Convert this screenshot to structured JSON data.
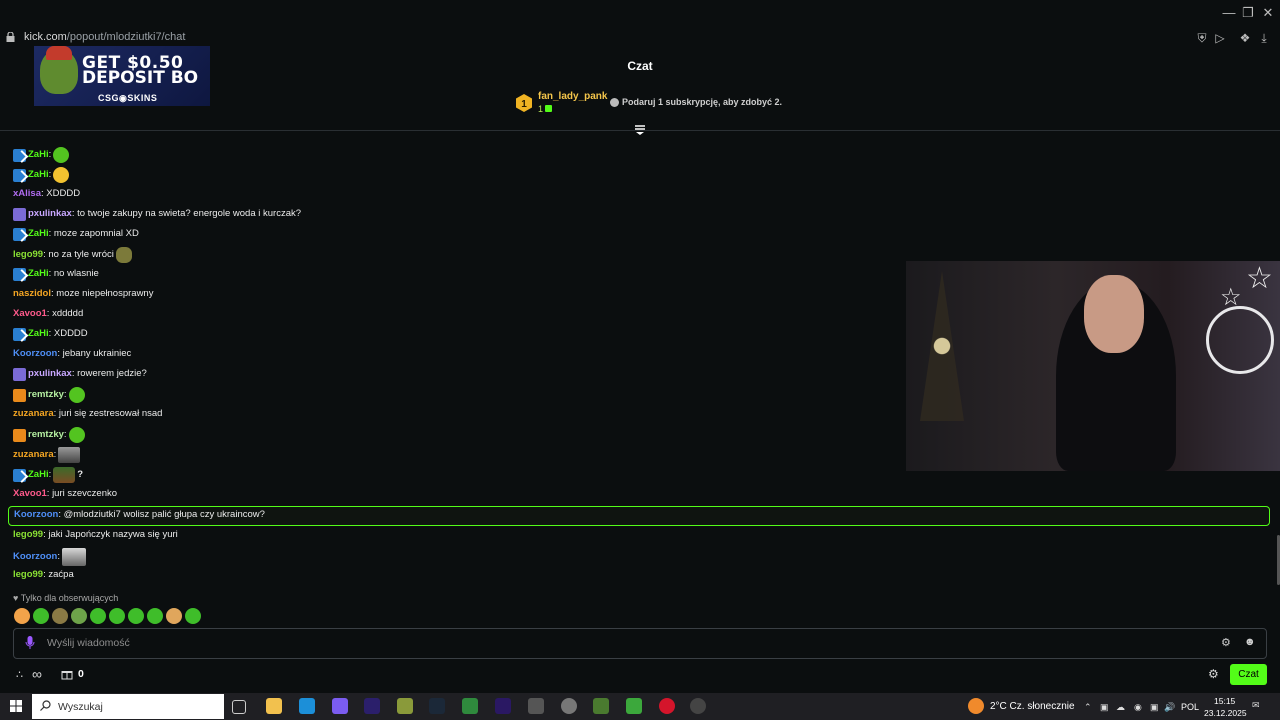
{
  "browser": {
    "url_host": "kick.com",
    "url_path": "/popout/mlodziutki7/chat"
  },
  "ad": {
    "line1": "GET $0.50",
    "line2": "DEPOSIT BO",
    "brand": "CSG◉SKINS"
  },
  "chat": {
    "title": "Czat",
    "leaderboard": {
      "rank": "1",
      "name": "fan_lady_pank",
      "count": "1"
    },
    "sub_prompt": "Podaruj 1 subskrypcję, aby zdobyć 2.",
    "messages": [
      {
        "user": "ZaHi",
        "text": ":"
      },
      {
        "user": "ZaHi",
        "text": ":"
      },
      {
        "user": "xAlisa",
        "text": ": XDDDD"
      },
      {
        "user": "pxulinkax",
        "text": ": to twoje zakupy na swieta? energole woda i kurczak?"
      },
      {
        "user": "ZaHi",
        "text": ": moze zapomnial XD"
      },
      {
        "user": "lego99",
        "text": ": no za tyle wróci"
      },
      {
        "user": "ZaHi",
        "text": ": no wlasnie"
      },
      {
        "user": "naszidol",
        "text": ": moze niepełnosprawny"
      },
      {
        "user": "Xavoo1",
        "text": ": xddddd"
      },
      {
        "user": "ZaHi",
        "text": ": XDDDD"
      },
      {
        "user": "Koorzoon",
        "text": ": jebany ukrainiec"
      },
      {
        "user": "pxulinkax",
        "text": ": rowerem jedzie?"
      },
      {
        "user": "remtzky",
        "text": ":"
      },
      {
        "user": "zuzanara",
        "text": ": juri się zestresował nsad"
      },
      {
        "user": "remtzky",
        "text": ":"
      },
      {
        "user": "zuzanara",
        "text": ":"
      },
      {
        "user": "ZaHi",
        "text": ":"
      },
      {
        "user": "Xavoo1",
        "text": ": juri szevczenko"
      },
      {
        "user": "Koorzoon",
        "text": ": @mlodziutki7 wolisz palić głupa czy ukraincow?"
      },
      {
        "user": "lego99",
        "text": ": jaki Japończyk nazywa się yuri"
      },
      {
        "user": "Koorzoon",
        "text": ":"
      },
      {
        "user": "lego99",
        "text": ": zaćpa"
      }
    ],
    "question_mark": "?",
    "followers_only": "Tylko dla obserwujących",
    "input_placeholder": "Wyślij wiadomość",
    "gift_count": "0",
    "chat_button": "Czat"
  },
  "colors": {
    "accent": "#53fc18",
    "user_green": "#53fc18",
    "user_purple": "#b06cf0",
    "user_blue": "#4f8ff7",
    "user_orange": "#f5a623",
    "user_pink": "#ff5a8c",
    "user_lime": "#8ae234"
  },
  "taskbar": {
    "search_placeholder": "Wyszukaj",
    "weather": "2°C  Cz. słonecznie",
    "language": "POL",
    "time": "15:15",
    "date": "23.12.2025"
  }
}
